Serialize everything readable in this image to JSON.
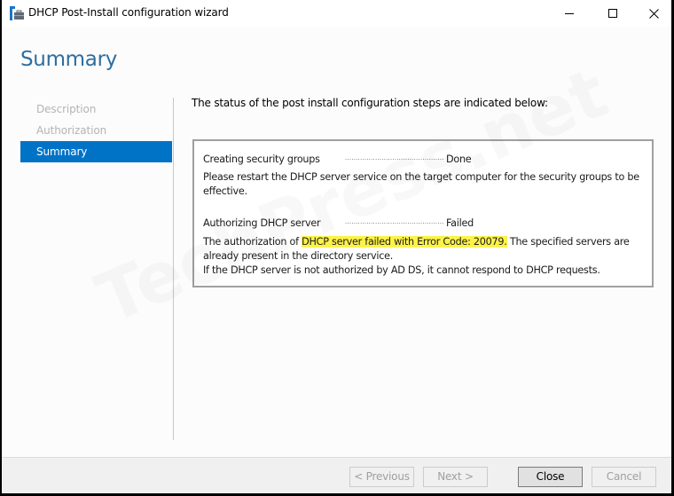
{
  "window": {
    "title": "DHCP Post-Install configuration wizard",
    "icon": "dhcp-server-icon",
    "controls": {
      "minimize": "minimize-icon",
      "maximize": "maximize-icon",
      "close": "close-icon"
    }
  },
  "page": {
    "title": "Summary",
    "intro": "The status of the post install configuration steps are indicated below:"
  },
  "nav": {
    "items": [
      {
        "label": "Description",
        "state": "disabled"
      },
      {
        "label": "Authorization",
        "state": "disabled"
      },
      {
        "label": "Summary",
        "state": "active"
      }
    ]
  },
  "status": {
    "steps": [
      {
        "name": "Creating security groups",
        "dots": "...................................................",
        "result": "Done",
        "message": "Please restart the DHCP server service on the target computer for the security groups to be effective."
      },
      {
        "name": "Authorizing DHCP server",
        "dots": "...................................................",
        "result": "Failed",
        "message_prefix": "The authorization of ",
        "message_highlight": "DHCP server failed with Error Code: 20079.",
        "message_suffix": " The specified servers are already present in the directory service.",
        "message_line2": "If the DHCP server is not authorized by AD DS, it cannot respond to DHCP requests."
      }
    ],
    "highlight_color": "#fcf34a"
  },
  "watermark": "TechPress.net",
  "footer": {
    "previous_label": "< Previous",
    "next_label": "Next >",
    "close_label": "Close",
    "cancel_label": "Cancel"
  },
  "colors": {
    "accent": "#0173c7",
    "title": "#2e6e9e"
  }
}
